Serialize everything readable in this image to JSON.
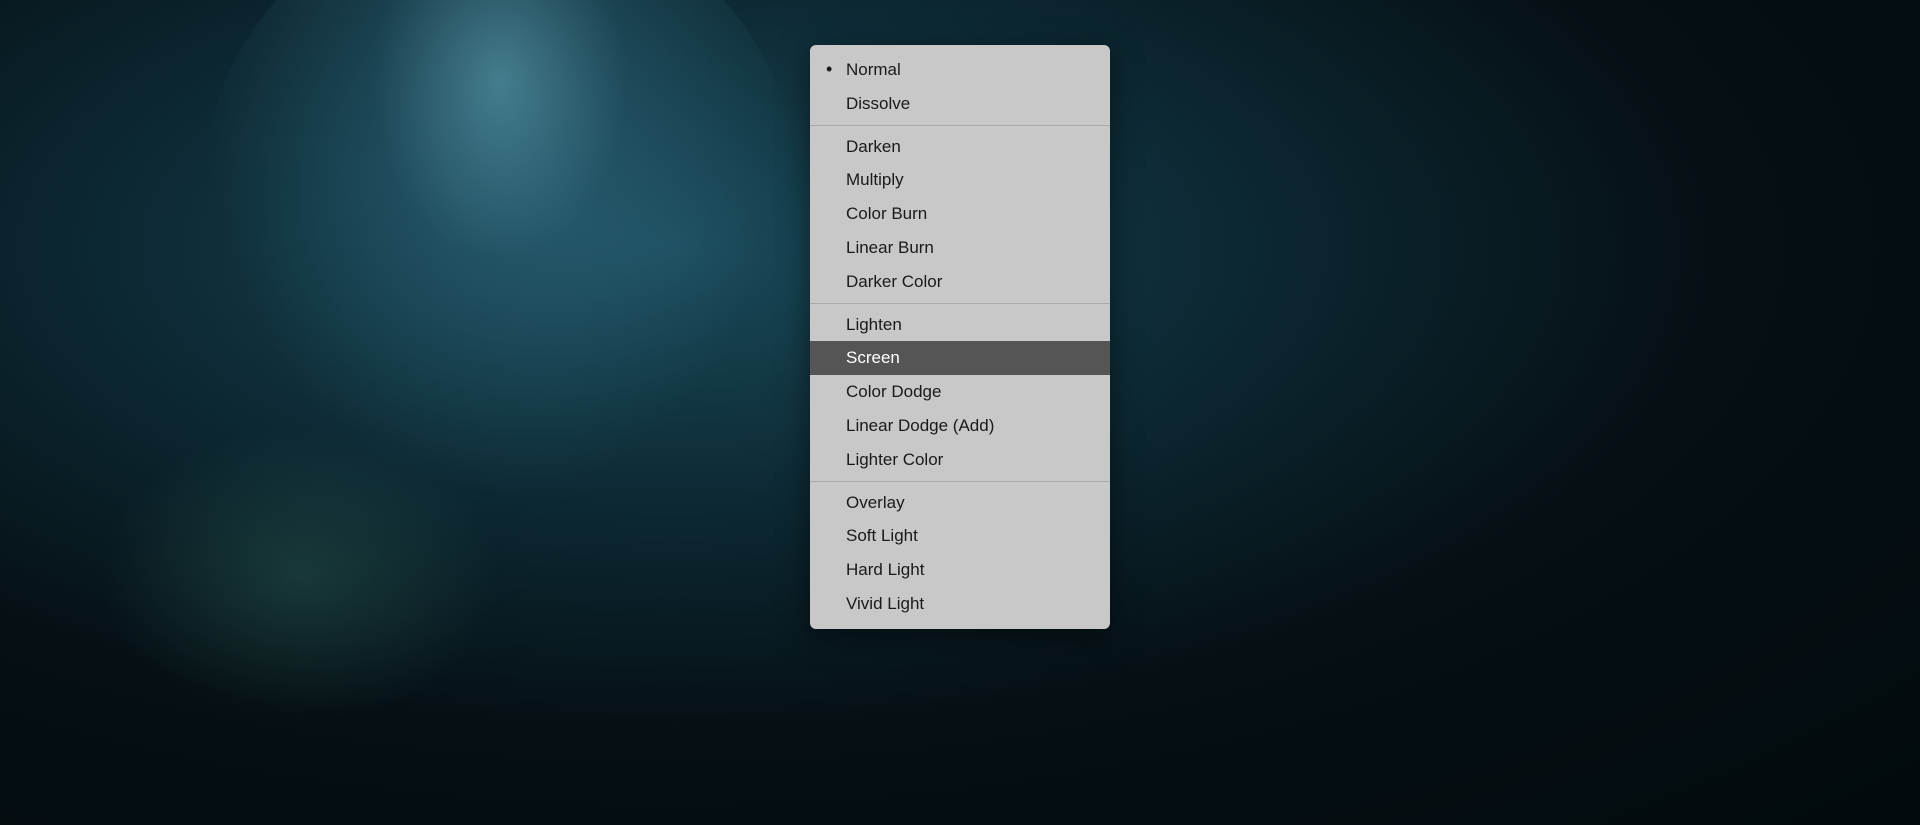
{
  "background": {
    "description": "Dark teal/blue photoshop-like background with spotlight"
  },
  "dropdown": {
    "groups": [
      {
        "id": "normal-group",
        "items": [
          {
            "id": "normal",
            "label": "Normal",
            "selected": true,
            "hasBullet": true
          },
          {
            "id": "dissolve",
            "label": "Dissolve",
            "selected": false,
            "hasBullet": false
          }
        ]
      },
      {
        "id": "darken-group",
        "items": [
          {
            "id": "darken",
            "label": "Darken",
            "selected": false,
            "hasBullet": false
          },
          {
            "id": "multiply",
            "label": "Multiply",
            "selected": false,
            "hasBullet": false
          },
          {
            "id": "color-burn",
            "label": "Color Burn",
            "selected": false,
            "hasBullet": false
          },
          {
            "id": "linear-burn",
            "label": "Linear Burn",
            "selected": false,
            "hasBullet": false
          },
          {
            "id": "darker-color",
            "label": "Darker Color",
            "selected": false,
            "hasBullet": false
          }
        ]
      },
      {
        "id": "lighten-group",
        "items": [
          {
            "id": "lighten",
            "label": "Lighten",
            "selected": false,
            "hasBullet": false
          },
          {
            "id": "screen",
            "label": "Screen",
            "selected": true,
            "highlighted": true,
            "hasBullet": false
          },
          {
            "id": "color-dodge",
            "label": "Color Dodge",
            "selected": false,
            "hasBullet": false
          },
          {
            "id": "linear-dodge",
            "label": "Linear Dodge (Add)",
            "selected": false,
            "hasBullet": false
          },
          {
            "id": "lighter-color",
            "label": "Lighter Color",
            "selected": false,
            "hasBullet": false
          }
        ]
      },
      {
        "id": "overlay-group",
        "items": [
          {
            "id": "overlay",
            "label": "Overlay",
            "selected": false,
            "hasBullet": false
          },
          {
            "id": "soft-light",
            "label": "Soft Light",
            "selected": false,
            "hasBullet": false
          },
          {
            "id": "hard-light",
            "label": "Hard Light",
            "selected": false,
            "hasBullet": false
          },
          {
            "id": "vivid-light",
            "label": "Vivid Light",
            "selected": false,
            "hasBullet": false
          }
        ]
      }
    ]
  }
}
